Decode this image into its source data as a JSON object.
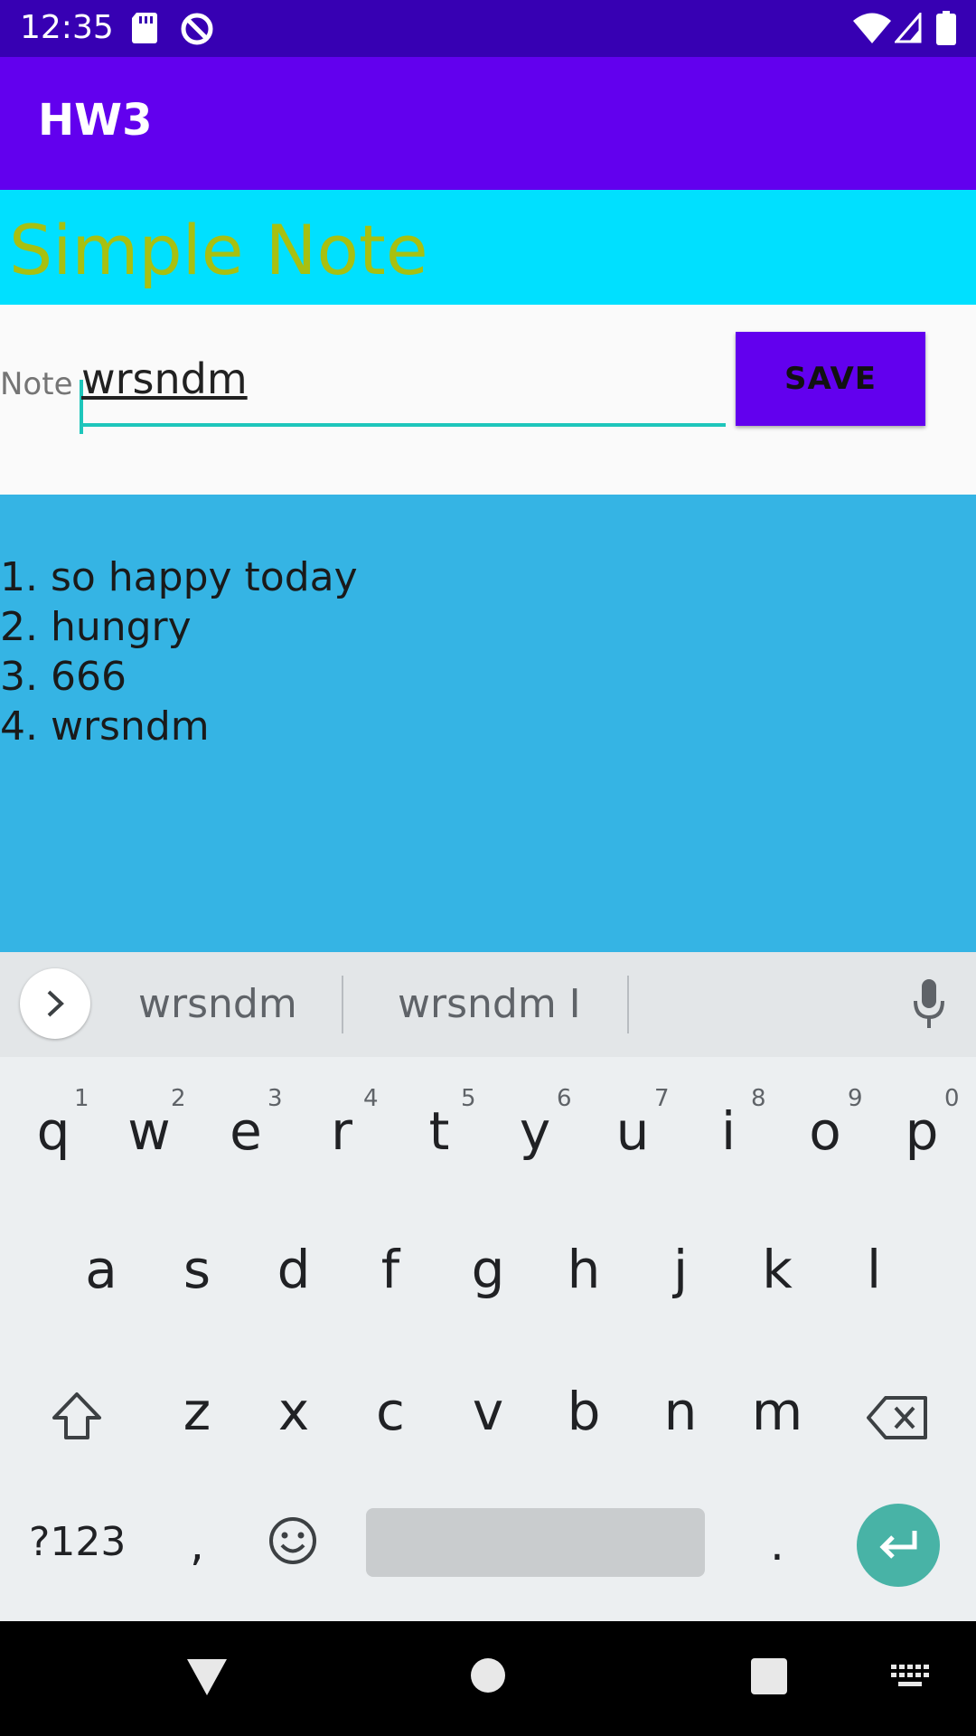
{
  "status_bar": {
    "time": "12:35"
  },
  "app_bar": {
    "title": "HW3"
  },
  "header": {
    "title": "Simple Note"
  },
  "input": {
    "label": "Note",
    "value": "wrsndm",
    "save_label": "SAVE"
  },
  "notes": [
    "1. so happy today",
    "2. hungry",
    "3. 666",
    "4. wrsndm"
  ],
  "keyboard": {
    "suggestions": [
      "wrsndm",
      "wrsndm I"
    ],
    "row1": [
      "q",
      "w",
      "e",
      "r",
      "t",
      "y",
      "u",
      "i",
      "o",
      "p"
    ],
    "row1_hints": [
      "1",
      "2",
      "3",
      "4",
      "5",
      "6",
      "7",
      "8",
      "9",
      "0"
    ],
    "row2": [
      "a",
      "s",
      "d",
      "f",
      "g",
      "h",
      "j",
      "k",
      "l"
    ],
    "row3": [
      "z",
      "x",
      "c",
      "v",
      "b",
      "n",
      "m"
    ],
    "symbols_label": "?123",
    "comma": ",",
    "period": "."
  },
  "colors": {
    "status_bar": "#3700b3",
    "app_bar": "#6200ee",
    "header": "#00e0ff",
    "header_text": "#a8c010",
    "notes_bg": "#35b4e4",
    "accent": "#1ec6bb"
  }
}
